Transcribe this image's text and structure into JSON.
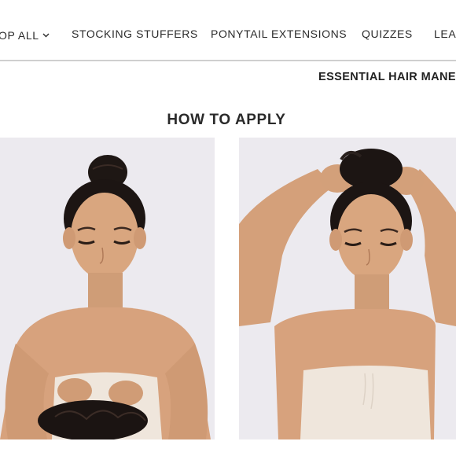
{
  "nav": {
    "items": [
      {
        "label": "OP ALL",
        "has_dropdown": true
      },
      {
        "label": "STOCKING STUFFERS"
      },
      {
        "label": "PONYTAIL EXTENSIONS"
      },
      {
        "label": "QUIZZES"
      },
      {
        "label": "LEA"
      }
    ]
  },
  "promo": {
    "text": "ESSENTIAL HAIR MANE-"
  },
  "section": {
    "title": "HOW TO APPLY"
  },
  "colors": {
    "skin": "#d7a27d",
    "hair": "#1c1513",
    "top": "#efe6dc",
    "background": "#ecebef"
  }
}
